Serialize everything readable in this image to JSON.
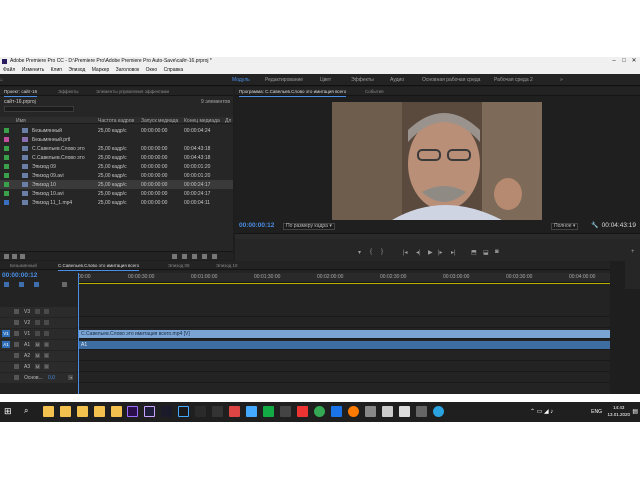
{
  "window": {
    "title": "Adobe Premiere Pro CC - D:\\Premiere Pro\\Adobe Premiere Pro Auto-Save\\сайт-16.prproj *"
  },
  "menu": [
    "Файл",
    "Изменить",
    "Клип",
    "Эпизод",
    "Маркер",
    "Заголовок",
    "Окно",
    "Справка"
  ],
  "workspaces": [
    "Модуль",
    "Редактирование",
    "Цвет",
    "Эффекты",
    "Аудио",
    "Основная рабочая среда",
    "Рабочая среда 2"
  ],
  "project_panel": {
    "tabs": [
      "Проект: сайт-16",
      "Эффекты",
      "Элементы управления эффектами"
    ],
    "file": "сайт-16.prproj",
    "count": "9 элементов",
    "columns": [
      "Имя",
      "Частота кадров",
      "Запуск медиада",
      "Конец медиада",
      "Дл"
    ],
    "rows": [
      {
        "name": "Безымянный",
        "fps": "25,00 кадр/с",
        "start": "00:00:00:00",
        "end": "00:00:04:24",
        "color": "#3aa04a"
      },
      {
        "name": "Безымянный.prtl",
        "fps": "",
        "start": "",
        "end": "",
        "color": "#c04da0"
      },
      {
        "name": "С.Савельев.Слово это",
        "fps": "25,00 кадр/с",
        "start": "00:00:00:00",
        "end": "00:04:43:18",
        "color": "#3aa04a"
      },
      {
        "name": "С.Савельев.Слово это",
        "fps": "25,00 кадр/с",
        "start": "00:00:00:00",
        "end": "00:04:43:18",
        "color": "#3aa04a"
      },
      {
        "name": "Эпизод 09",
        "fps": "25,00 кадр/с",
        "start": "00:00:00:00",
        "end": "00:00:01:20",
        "color": "#3aa04a"
      },
      {
        "name": "Эпизод 09.avi",
        "fps": "25,00 кадр/с",
        "start": "00:00:00:00",
        "end": "00:00:01:20",
        "color": "#3aa04a"
      },
      {
        "name": "Эпизод 10",
        "fps": "25,00 кадр/с",
        "start": "00:00:00:00",
        "end": "00:00:24:17",
        "color": "#3aa04a"
      },
      {
        "name": "Эпизод 10.avi",
        "fps": "25,00 кадр/с",
        "start": "00:00:00:00",
        "end": "00:00:24:17",
        "color": "#3aa04a"
      },
      {
        "name": "Эпизод 11_1.mp4",
        "fps": "25,00 кадр/с",
        "start": "00:00:00:00",
        "end": "00:00:04:11",
        "color": "#3a6fc0"
      }
    ]
  },
  "program_monitor": {
    "tabs": [
      "Программа: С.Савельев.Слово это имитация всего",
      "События"
    ],
    "timecode_left": "00:00:00:12",
    "fit": "По размеру кадра",
    "quality": "Полное",
    "timecode_right": "00:04:43:19"
  },
  "timeline": {
    "tabs": [
      "Безымянный",
      "С.Савельев.Слово это имитация всего",
      "Эпизод 09",
      "Эпизод 10"
    ],
    "timecode": "00:00:00:12",
    "ruler": [
      "00:00",
      "00:00:30:00",
      "00:01:00:00",
      "00:01:30:00",
      "00:02:00:00",
      "00:02:30:00",
      "00:03:00:00",
      "00:03:30:00",
      "00:04:00:00"
    ],
    "video_tracks": [
      "V3",
      "V2",
      "V1"
    ],
    "audio_tracks": [
      "A1",
      "A2",
      "A3"
    ],
    "master": "Основ...",
    "master_value": "0,0",
    "clip_video": "С.Савельев.Слово это имитация всего.mp4 [V]",
    "clip_audio": "A1"
  },
  "taskbar": {
    "lang": "ENG",
    "time": "14:43",
    "date": "13.01.2020"
  }
}
